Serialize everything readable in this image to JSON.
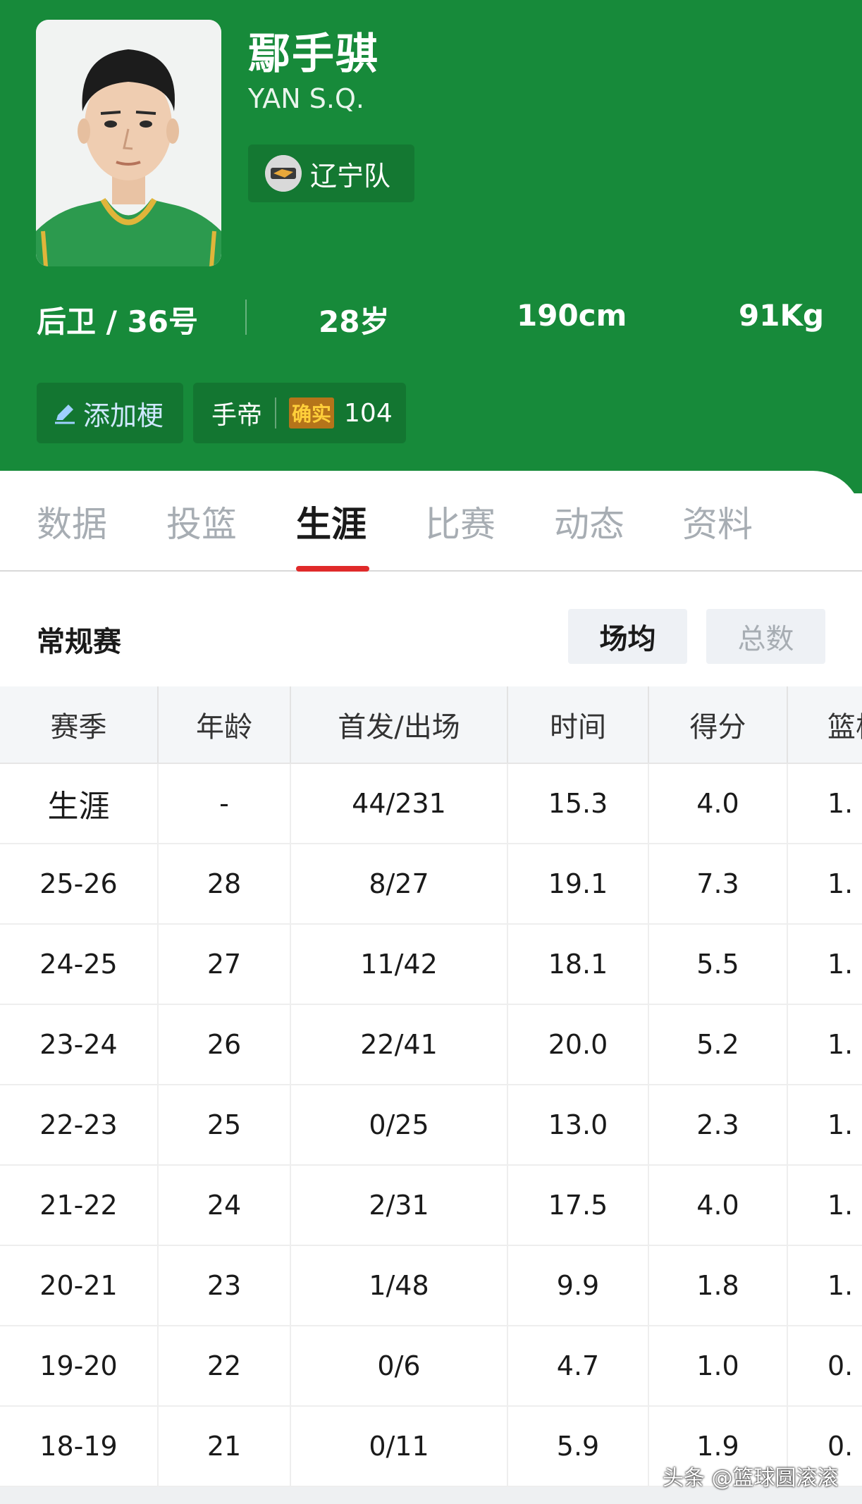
{
  "player": {
    "name_cn": "鄢手骐",
    "name_en": "YAN S.Q.",
    "team": "辽宁队",
    "position_number": "后卫 / 36号",
    "age": "28岁",
    "height": "190cm",
    "weight": "91Kg"
  },
  "actions": {
    "add_meme": "添加梗",
    "emperor_label": "手帝",
    "emperor_tag": "确实",
    "emperor_count": "104"
  },
  "tabs": [
    {
      "label": "数据"
    },
    {
      "label": "投篮"
    },
    {
      "label": "生涯"
    },
    {
      "label": "比赛"
    },
    {
      "label": "动态"
    },
    {
      "label": "资料"
    }
  ],
  "section": {
    "title": "常规赛",
    "seg_avg": "场均",
    "seg_total": "总数"
  },
  "table": {
    "headers": [
      "赛季",
      "年龄",
      "首发/出场",
      "时间",
      "得分",
      "篮板"
    ],
    "rows": [
      [
        "生涯",
        "-",
        "44/231",
        "15.3",
        "4.0",
        "1."
      ],
      [
        "25-26",
        "28",
        "8/27",
        "19.1",
        "7.3",
        "1."
      ],
      [
        "24-25",
        "27",
        "11/42",
        "18.1",
        "5.5",
        "1."
      ],
      [
        "23-24",
        "26",
        "22/41",
        "20.0",
        "5.2",
        "1."
      ],
      [
        "22-23",
        "25",
        "0/25",
        "13.0",
        "2.3",
        "1."
      ],
      [
        "21-22",
        "24",
        "2/31",
        "17.5",
        "4.0",
        "1."
      ],
      [
        "20-21",
        "23",
        "1/48",
        "9.9",
        "1.8",
        "1."
      ],
      [
        "19-20",
        "22",
        "0/6",
        "4.7",
        "1.0",
        "0."
      ],
      [
        "18-19",
        "21",
        "0/11",
        "5.9",
        "1.9",
        "0."
      ]
    ]
  },
  "watermark": "头条 @篮球圆滚滚",
  "colors": {
    "header_green": "#178a3a",
    "tab_active_underline": "#e02a2a",
    "tab_inactive": "#a7adb3"
  }
}
